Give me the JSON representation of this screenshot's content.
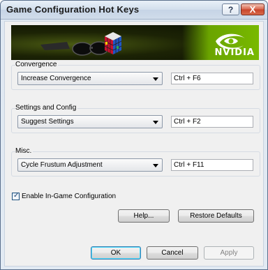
{
  "window": {
    "title": "Game Configuration Hot Keys",
    "help_glyph": "?",
    "close_glyph": "X"
  },
  "banner": {
    "brand": "NVIDIA",
    "colors": {
      "brand_green": "#76b900",
      "dark": "#1c2305"
    }
  },
  "groups": [
    {
      "label": "Convergence",
      "action": "Increase Convergence",
      "hotkey": "Ctrl + F6"
    },
    {
      "label": "Settings and Config",
      "action": "Suggest Settings",
      "hotkey": "Ctrl + F2"
    },
    {
      "label": "Misc.",
      "action": "Cycle Frustum Adjustment",
      "hotkey": "Ctrl + F11"
    }
  ],
  "options": {
    "enable_ingame_label": "Enable In-Game Configuration",
    "enable_ingame_checked": true
  },
  "buttons": {
    "help": "Help...",
    "restore_defaults": "Restore Defaults",
    "ok": "OK",
    "cancel": "Cancel",
    "apply": "Apply"
  },
  "icons": {
    "dropdown": "chevron-down-icon",
    "check": "checkmark-icon",
    "logo": "nvidia-eye-logo",
    "product_art": "stereo-glasses-and-cube"
  }
}
